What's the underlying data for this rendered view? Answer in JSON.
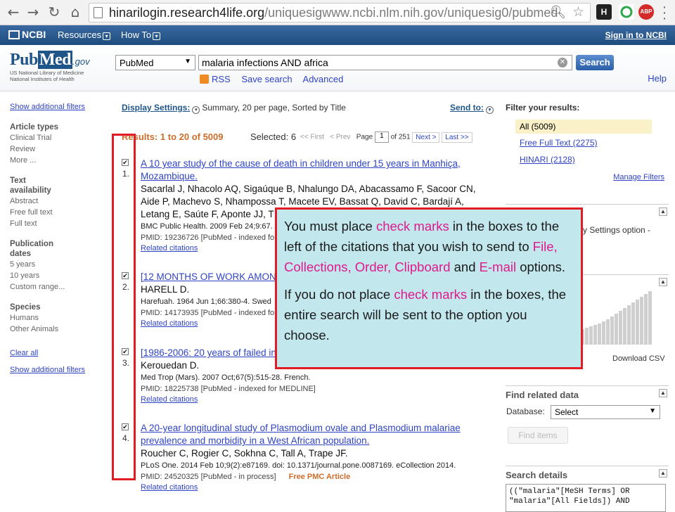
{
  "browser": {
    "url_host": "hinarilogin.research4life.org",
    "url_path": "/uniquesigwww.ncbi.nlm.nih.gov/uniquesig0/pubmed",
    "ext_labels": [
      "H",
      "ABP"
    ]
  },
  "ncbi": {
    "logo": "NCBI",
    "menu": [
      "Resources",
      "How To"
    ],
    "signin": "Sign in to NCBI"
  },
  "pubmed": {
    "logo_pub": "Pub",
    "logo_med": "Med",
    "logo_gov": ".gov",
    "sub_line1": "US National Library of Medicine",
    "sub_line2": "National Institutes of Health",
    "db_value": "PubMed",
    "query": "malaria infections AND africa",
    "search_label": "Search",
    "links": [
      "RSS",
      "Save search",
      "Advanced"
    ],
    "help": "Help"
  },
  "sidebar": {
    "show_filters_top": "Show additional filters",
    "groups": [
      {
        "head": "Article types",
        "items": [
          "Clinical Trial",
          "Review",
          "More ..."
        ]
      },
      {
        "head": "Text availability",
        "items": [
          "Abstract",
          "Free full text",
          "Full text"
        ]
      },
      {
        "head": "Publication dates",
        "items": [
          "5 years",
          "10 years",
          "Custom range..."
        ]
      },
      {
        "head": "Species",
        "items": [
          "Humans",
          "Other Animals"
        ]
      }
    ],
    "clear_all": "Clear all",
    "show_filters_bottom": "Show additional filters"
  },
  "display": {
    "label": "Display Settings:",
    "value": "Summary, 20 per page, Sorted by Title",
    "send_to": "Send to:"
  },
  "results": {
    "heading": "Results: 1 to 20 of 5009",
    "selected": "Selected: 6",
    "first": "<< First",
    "prev": "< Prev",
    "page_label": "Page",
    "page_value": "1",
    "of_pages": "of 251",
    "next": "Next >",
    "last": "Last >>"
  },
  "citations": [
    {
      "num": "1.",
      "checked": "✔",
      "title_l1": "A 10 year study of the cause of death in children under 15 years in Manhiça,",
      "title_l2": "Mozambique.",
      "auth_l1": "Sacarlal J, Nhacolo AQ, Sigaúque B, Nhalungo DA, Abacassamo F, Sacoor CN,",
      "auth_l2": "Aide P, Machevo S, Nhampossa T, Macete EV, Bassat Q, David C, Bardají A,",
      "auth_l3": "Letang E, Saúte F, Aponte JJ, T",
      "src": "BMC Public Health. 2009 Feb 24;9:67.",
      "pmid": "PMID: 19236726 [PubMed - indexed fo",
      "related": "Related citations"
    },
    {
      "num": "2.",
      "checked": "✔",
      "title_l1": "[12 MONTHS OF WORK AMON",
      "auth_l1": "HARELL D.",
      "src": "Harefuah. 1964 Jun 1;66:380-4. Swed",
      "pmid": "PMID: 14173935 [PubMed - indexed fo",
      "related": "Related citations"
    },
    {
      "num": "3.",
      "checked": "✔",
      "title_l1": "[1986-2006: 20 years of failed in",
      "auth_l1": "Kerouedan D.",
      "src": "Med Trop (Mars). 2007 Oct;67(5):515-28. French.",
      "pmid": "PMID: 18225738 [PubMed - indexed for MEDLINE]",
      "related": "Related citations"
    },
    {
      "num": "4.",
      "checked": "✔",
      "title_l1": "A 20-year longitudinal study of Plasmodium ovale and Plasmodium malariae",
      "title_l2": "prevalence and morbidity in a West African population.",
      "auth_l1": "Roucher C, Rogier C, Sokhna C, Tall A, Trape JF.",
      "src": "PLoS One. 2014 Feb 10;9(2):e87169. doi: 10.1371/journal.pone.0087169. eCollection 2014.",
      "pmid": "PMID: 24520325 [PubMed - in process]",
      "pmc": "Free PMC Article",
      "related": "Related citations"
    }
  ],
  "right": {
    "filter_head": "Filter your results:",
    "all": "All (5009)",
    "free_full_text": "Free Full Text (2275)",
    "hinari": "HINARI (2128)",
    "manage": "Manage Filters",
    "settings_fragment": "y Settings option -",
    "download_csv": "Download CSV",
    "find_related": "Find related data",
    "database_label": "Database:",
    "database_value": "Select",
    "find_items": "Find items",
    "search_details": "Search details",
    "details_text": "((\"malaria\"[MeSH Terms] OR\n\"malaria\"[All Fields]) AND"
  },
  "callout": {
    "p1_a": "You must place ",
    "p1_hl1": "check marks",
    "p1_b": " in the boxes to the left of the citations that you wish to send to ",
    "p1_hl2": "File, Collections, Order, Clipboard",
    "p1_c": " and ",
    "p1_hl3": "E-mail",
    "p1_d": " options.",
    "p2_a": "If you do not place ",
    "p2_hl1": "check marks",
    "p2_b": " in the boxes, the entire search will be sent to the option you choose."
  },
  "colors": {
    "ncbi_blue": "#26568a",
    "link": "#2f44c4",
    "result_orange": "#cc6d2b",
    "highlight_red": "#e11c24",
    "callout_bg": "#c2e8ee",
    "callout_pink": "#e0198b"
  }
}
